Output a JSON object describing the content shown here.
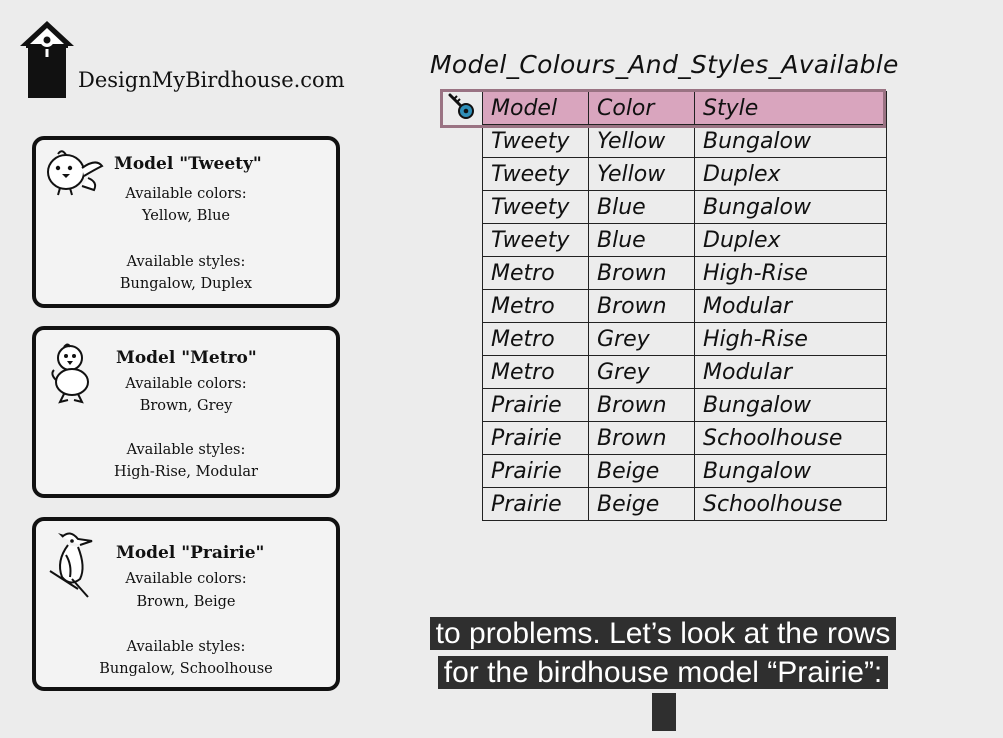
{
  "site": {
    "name": "DesignMyBirdhouse.com"
  },
  "cards": [
    {
      "title": "Model \"Tweety\"",
      "colors_label": "Available colors:",
      "colors": "Yellow, Blue",
      "styles_label": "Available styles:",
      "styles": "Bungalow, Duplex"
    },
    {
      "title": "Model \"Metro\"",
      "colors_label": "Available colors:",
      "colors": "Brown, Grey",
      "styles_label": "Available styles:",
      "styles": "High-Rise, Modular"
    },
    {
      "title": "Model \"Prairie\"",
      "colors_label": "Available colors:",
      "colors": "Brown, Beige",
      "styles_label": "Available styles:",
      "styles": "Bungalow, Schoolhouse"
    }
  ],
  "table": {
    "title": "Model_Colours_And_Styles_Available",
    "headers": [
      "Model",
      "Color",
      "Style"
    ],
    "rows": [
      [
        "Tweety",
        "Yellow",
        "Bungalow"
      ],
      [
        "Tweety",
        "Yellow",
        "Duplex"
      ],
      [
        "Tweety",
        "Blue",
        "Bungalow"
      ],
      [
        "Tweety",
        "Blue",
        "Duplex"
      ],
      [
        "Metro",
        "Brown",
        "High-Rise"
      ],
      [
        "Metro",
        "Brown",
        "Modular"
      ],
      [
        "Metro",
        "Grey",
        "High-Rise"
      ],
      [
        "Metro",
        "Grey",
        "Modular"
      ],
      [
        "Prairie",
        "Brown",
        "Bungalow"
      ],
      [
        "Prairie",
        "Brown",
        "Schoolhouse"
      ],
      [
        "Prairie",
        "Beige",
        "Bungalow"
      ],
      [
        "Prairie",
        "Beige",
        "Schoolhouse"
      ]
    ],
    "header_color": "#d9a5be",
    "key_icon": "key-icon"
  },
  "caption": {
    "line1": "to problems. Let’s look at the rows",
    "line2": "for the birdhouse model “Prairie”:"
  }
}
